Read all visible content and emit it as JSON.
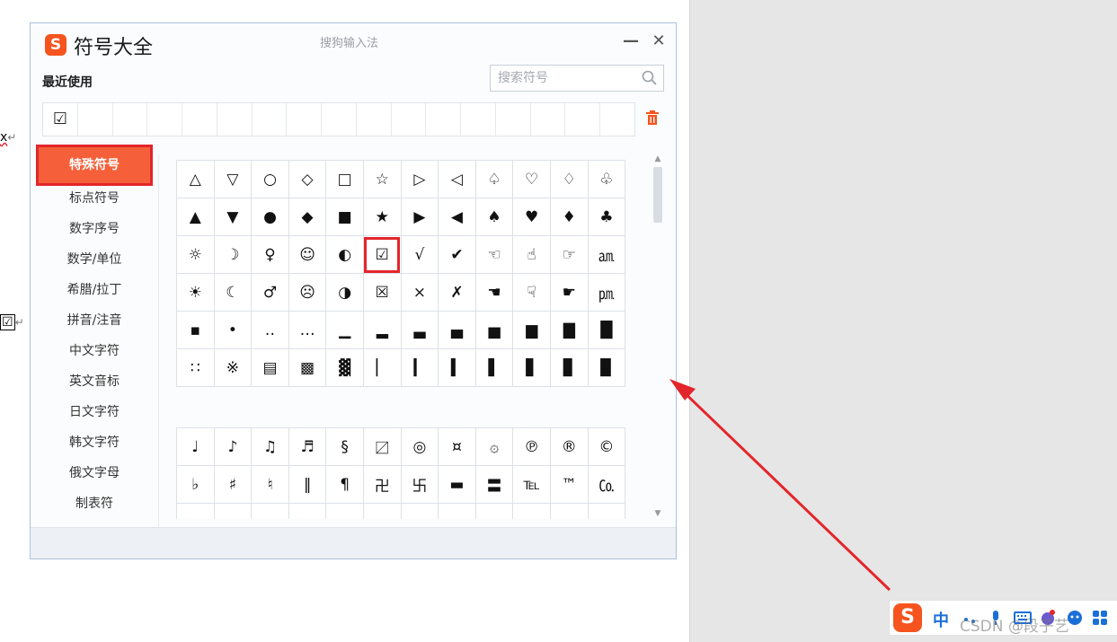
{
  "document": {
    "fragment_x": "x",
    "fragment_box": "☑",
    "return_mark": "↵"
  },
  "dialog": {
    "logo_letter": "S",
    "title": "符号大全",
    "subtitle": "搜狗输入法",
    "minimize_glyph": "—",
    "close_glyph": "✕",
    "recent_label": "最近使用",
    "search_placeholder": "搜索符号",
    "recent_symbols": [
      "☑",
      "",
      "",
      "",
      "",
      "",
      "",
      "",
      "",
      "",
      "",
      "",
      "",
      "",
      "",
      "",
      ""
    ]
  },
  "categories": [
    {
      "label": "特殊符号",
      "active": true
    },
    {
      "label": "标点符号"
    },
    {
      "label": "数字序号"
    },
    {
      "label": "数学/单位"
    },
    {
      "label": "希腊/拉丁"
    },
    {
      "label": "拼音/注音"
    },
    {
      "label": "中文字符"
    },
    {
      "label": "英文音标"
    },
    {
      "label": "日文字符"
    },
    {
      "label": "韩文字符"
    },
    {
      "label": "俄文字母"
    },
    {
      "label": "制表符"
    }
  ],
  "symbol_grid_1": [
    [
      "△",
      "▽",
      "○",
      "◇",
      "□",
      "☆",
      "▷",
      "◁",
      "♤",
      "♡",
      "♢",
      "♧"
    ],
    [
      "▲",
      "▼",
      "●",
      "◆",
      "■",
      "★",
      "▶",
      "◀",
      "♠",
      "♥",
      "♦",
      "♣"
    ],
    [
      "☼",
      "☽",
      "♀",
      "☺",
      "◐",
      "☑",
      "√",
      "✔",
      "☜",
      "☝",
      "☞",
      "㏂"
    ],
    [
      "☀",
      "☾",
      "♂",
      "☹",
      "◑",
      "☒",
      "×",
      "✗",
      "☚",
      "☟",
      "☛",
      "㏘"
    ],
    [
      "▪",
      "•",
      "‥",
      "…",
      "▁",
      "▂",
      "▃",
      "▄",
      "▅",
      "▆",
      "▇",
      "█"
    ],
    [
      "∷",
      "※",
      "▤",
      "▩",
      "▓",
      "▏",
      "▎",
      "▍",
      "▌",
      "▋",
      "▊",
      "▉"
    ]
  ],
  "highlighted_symbol": "☑",
  "symbol_grid_2": [
    [
      "♩",
      "♪",
      "♫",
      "♬",
      "§",
      "〼",
      "◎",
      "¤",
      "۞",
      "℗",
      "®",
      "©"
    ],
    [
      "♭",
      "♯",
      "♮",
      "‖",
      "¶",
      "卍",
      "卐",
      "▬",
      "〓",
      "℡",
      "™",
      "㏇"
    ],
    [
      "",
      "",
      "",
      "",
      "",
      "",
      "",
      "",
      "",
      "",
      "",
      ""
    ]
  ],
  "ime_bar": {
    "logo_letter": "S",
    "mode": "中",
    "icons": [
      "punctuation-icon",
      "microphone-icon",
      "keyboard-icon",
      "skin-icon",
      "assistant-icon",
      "toolbox-icon"
    ]
  },
  "watermark": "CSDN @段子艺",
  "colors": {
    "brand_orange": "#f5541f",
    "highlight_red": "#e3262b",
    "active_category": "#f5603a"
  }
}
